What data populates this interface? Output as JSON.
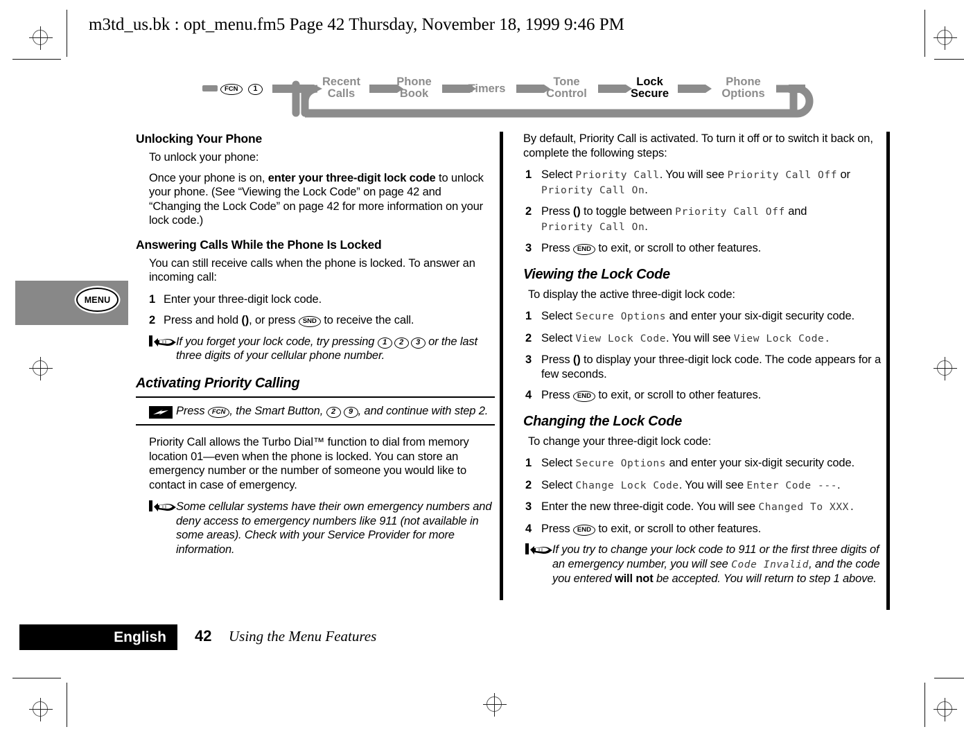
{
  "running_header": "m3td_us.bk : opt_menu.fm5  Page 42  Thursday, November 18, 1999  9:46 PM",
  "menu_map": {
    "start_keys": [
      "FCN",
      "1"
    ],
    "items": [
      {
        "line1": "Recent",
        "line2": "Calls",
        "active": false
      },
      {
        "line1": "Phone",
        "line2": "Book",
        "active": false
      },
      {
        "line1": "Timers",
        "line2": "",
        "active": false
      },
      {
        "line1": "Tone",
        "line2": "Control",
        "active": false
      },
      {
        "line1": "Lock",
        "line2": "Secure",
        "active": true
      },
      {
        "line1": "Phone",
        "line2": "Options",
        "active": false
      }
    ],
    "active_color": "#000000",
    "inactive_color": "#8c8c8c",
    "connector_color": "#8c8c8c"
  },
  "thumb_tab": {
    "label": "MENU",
    "background": "#888888"
  },
  "left_column": {
    "section1": {
      "heading": "Unlocking Your Phone",
      "lead": "To unlock your phone:",
      "para_a": "Once your phone is on, ",
      "para_b": "enter your three-digit lock code",
      "para_c": " to unlock your phone. (See “Viewing the Lock Code” on page 42 and “Changing the Lock Code” on page 42 for more information on your lock code.)"
    },
    "section2": {
      "heading": "Answering Calls While the Phone Is Locked",
      "lead": "You can still receive calls when the phone is locked. To answer an incoming call:",
      "step1_num": "1",
      "step1_text": "Enter your three-digit lock code.",
      "step2_num": "2",
      "step2_a": "Press and hold ",
      "step2_paren": "()",
      "step2_b": ", or press ",
      "step2_key": "SND",
      "step2_c": " to receive the call.",
      "note_a": "If you forget your lock code, try pressing ",
      "note_keys": [
        "1",
        "2",
        "3"
      ],
      "note_b": " or the last three digits of your cellular phone number."
    },
    "section3": {
      "heading": "Activating Priority Calling",
      "tip_a": "Press ",
      "tip_key1": "FCN",
      "tip_b": ", the Smart Button, ",
      "tip_key2": "2",
      "tip_key3": "9",
      "tip_c": ", and continue with step 2.",
      "para": "Priority Call allows the Turbo Dial™ function to dial from memory location 01—even when the phone is locked. You can store an emergency number or the number of someone you would like to contact in case of emergency.",
      "note": "Some cellular systems have their own emergency numbers and deny access to emergency numbers like 911 (not available in some areas). Check with your Service Provider for more information."
    }
  },
  "right_column": {
    "intro": "By default, Priority Call is activated. To turn it off or to switch it back on, complete the following steps:",
    "steps": [
      {
        "num": "1",
        "a": "Select ",
        "lcd1": "Priority Call",
        "b": ". You will see ",
        "lcd2": "Priority Call Off",
        "c": " or ",
        "lcd3": "Priority Call On",
        "d": "."
      },
      {
        "num": "2",
        "a": "Press ",
        "paren": "()",
        "b": " to toggle between ",
        "lcd1": "Priority Call Off",
        "c": " and ",
        "lcd2": "Priority Call On",
        "d": "."
      },
      {
        "num": "3",
        "a": "Press ",
        "key": "END",
        "b": " to exit, or scroll to other features."
      }
    ],
    "section_view": {
      "heading": "Viewing the Lock Code",
      "lead": "To display the active three-digit lock code:",
      "steps": [
        {
          "num": "1",
          "a": "Select ",
          "lcd1": "Secure Options",
          "b": " and enter your six-digit security code."
        },
        {
          "num": "2",
          "a": "Select ",
          "lcd1": "View Lock Code",
          "b": ". You will see ",
          "lcd2": "View Lock Code.",
          "c": ""
        },
        {
          "num": "3",
          "a": "Press ",
          "paren": "()",
          "b": " to display your three-digit lock code. The code appears for a few seconds."
        },
        {
          "num": "4",
          "a": "Press ",
          "key": "END",
          "b": " to exit, or scroll to other features."
        }
      ]
    },
    "section_change": {
      "heading": "Changing the Lock Code",
      "lead": "To change your three-digit lock code:",
      "steps": [
        {
          "num": "1",
          "a": "Select ",
          "lcd1": "Secure Options",
          "b": " and enter your six-digit security code."
        },
        {
          "num": "2",
          "a": "Select ",
          "lcd1": "Change Lock Code",
          "b": ". You will see ",
          "lcd2": "Enter Code ---",
          "c": "."
        },
        {
          "num": "3",
          "a": "Enter the new three-digit code. You will see ",
          "lcd1": "Changed To XXX.",
          "b": ""
        },
        {
          "num": "4",
          "a": "Press ",
          "key": "END",
          "b": " to exit, or scroll to other features."
        }
      ],
      "note_a": "If you try to change your lock code to 911 or the first three digits of an emergency number, you will see ",
      "note_lcd": "Code Invalid",
      "note_b": ", and the code you entered ",
      "note_bold": "will not",
      "note_c": " be accepted. You will return to step 1 above."
    }
  },
  "footer": {
    "language": "English",
    "page_number": "42",
    "chapter": "Using the Menu Features"
  }
}
